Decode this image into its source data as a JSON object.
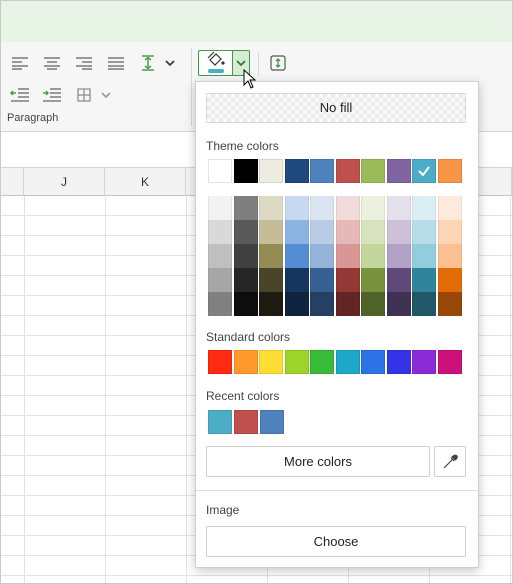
{
  "ribbon": {
    "group_label": "Paragraph",
    "icons": [
      "align-left-icon",
      "align-center-icon",
      "align-right-icon",
      "justify-icon",
      "line-spacing-icon",
      "decrease-indent-icon",
      "increase-indent-icon",
      "cell-borders-icon",
      "fill-color-icon",
      "vertical-align-icon"
    ]
  },
  "columns": [
    "J",
    "K"
  ],
  "fill_popup": {
    "no_fill_label": "No fill",
    "theme_label": "Theme colors",
    "theme_colors": [
      "#ffffff",
      "#000000",
      "#eeece1",
      "#1f497d",
      "#4f81bd",
      "#c0504d",
      "#9bbb59",
      "#8064a2",
      "#4bacc6",
      "#f79646"
    ],
    "selected_theme_index": 8,
    "theme_shades": [
      [
        "#f2f2f2",
        "#d9d9d9",
        "#bfbfbf",
        "#a6a6a6",
        "#808080"
      ],
      [
        "#7f7f7f",
        "#595959",
        "#404040",
        "#262626",
        "#0d0d0d"
      ],
      [
        "#ddd9c3",
        "#c4bd97",
        "#948a54",
        "#4a452a",
        "#1d1b10"
      ],
      [
        "#c6d9f0",
        "#8db3e2",
        "#548dd4",
        "#17365d",
        "#0f243e"
      ],
      [
        "#dbe5f1",
        "#b8cce4",
        "#95b3d7",
        "#366092",
        "#244062"
      ],
      [
        "#f2dcdb",
        "#e6b9b8",
        "#da9694",
        "#953735",
        "#632523"
      ],
      [
        "#ebf1dd",
        "#d7e3bc",
        "#c3d69b",
        "#76923c",
        "#4f6228"
      ],
      [
        "#e5e0ec",
        "#ccc1d9",
        "#b2a2c7",
        "#5f497a",
        "#3f3151"
      ],
      [
        "#dbeef3",
        "#b7dde8",
        "#92cddc",
        "#31859b",
        "#205867"
      ],
      [
        "#fdeada",
        "#fbd5b5",
        "#fac08f",
        "#e36c09",
        "#974806"
      ]
    ],
    "standard_label": "Standard colors",
    "standard_colors": [
      "#ff2a10",
      "#ff9a2a",
      "#ffdd33",
      "#9ed42a",
      "#38bb38",
      "#1ea7c9",
      "#2b73e6",
      "#3433e8",
      "#8b2bd6",
      "#cc117a"
    ],
    "recent_label": "Recent colors",
    "recent_colors": [
      "#4bacc6",
      "#c0504d",
      "#4f81bd"
    ],
    "more_colors_label": "More colors",
    "eyedropper_icon": "eyedropper-icon",
    "image_label": "Image",
    "choose_label": "Choose"
  },
  "colors": {
    "accent": "#3e9a43",
    "fill_indicator": "#45b0c8",
    "topband": "#e8f4e6"
  }
}
